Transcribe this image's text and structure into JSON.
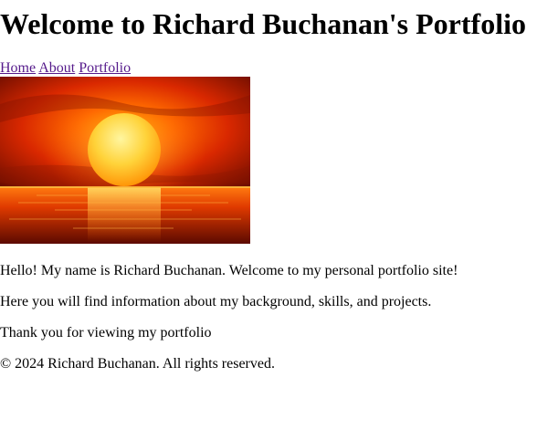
{
  "header": {
    "title": "Welcome to Richard Buchanan's Portfolio"
  },
  "nav": {
    "items": [
      {
        "label": "Home"
      },
      {
        "label": "About"
      },
      {
        "label": "Portfolio"
      }
    ],
    "link_color": "#551a8b"
  },
  "hero": {
    "icon": "sunset-image"
  },
  "content": {
    "paragraphs": [
      "Hello! My name is Richard Buchanan. Welcome to my personal portfolio site!",
      "Here you will find information about my background, skills, and projects.",
      "Thank you for viewing my portfolio"
    ]
  },
  "footer": {
    "text": "© 2024 Richard Buchanan. All rights reserved."
  }
}
